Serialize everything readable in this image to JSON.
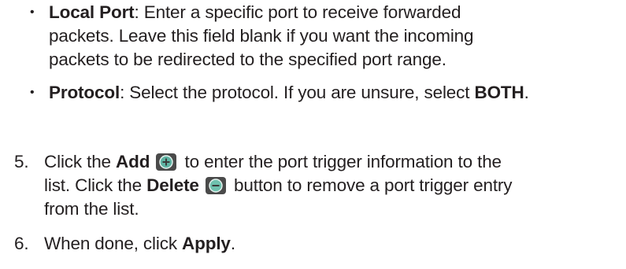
{
  "bullets": [
    {
      "term": "Local Port",
      "lines": [
        ": Enter a specific port to receive forwarded",
        "packets. Leave this field blank if you want the incoming",
        "packets to be redirected to the specified port range."
      ]
    },
    {
      "term": "Protocol",
      "text1": ": Select the protocol. If you are unsure, select ",
      "bold_value": "BOTH",
      "text2": "."
    }
  ],
  "steps": [
    {
      "number": "5.",
      "l1_before": "Click the ",
      "add_label": "Add",
      "l1_after": " to enter the port trigger information to the",
      "l2_before": "list. Click the ",
      "delete_label": "Delete",
      "l2_after": " button to remove a port trigger entry",
      "l3": "from the list."
    },
    {
      "number": "6.",
      "before": "When done, click ",
      "apply_label": "Apply",
      "after": "."
    }
  ],
  "icons": {
    "add": "add-circle-icon",
    "delete": "delete-circle-icon",
    "add_color": "#5fb3a3",
    "delete_color": "#6fc1ae",
    "icon_bg": "#4a4a4a"
  }
}
